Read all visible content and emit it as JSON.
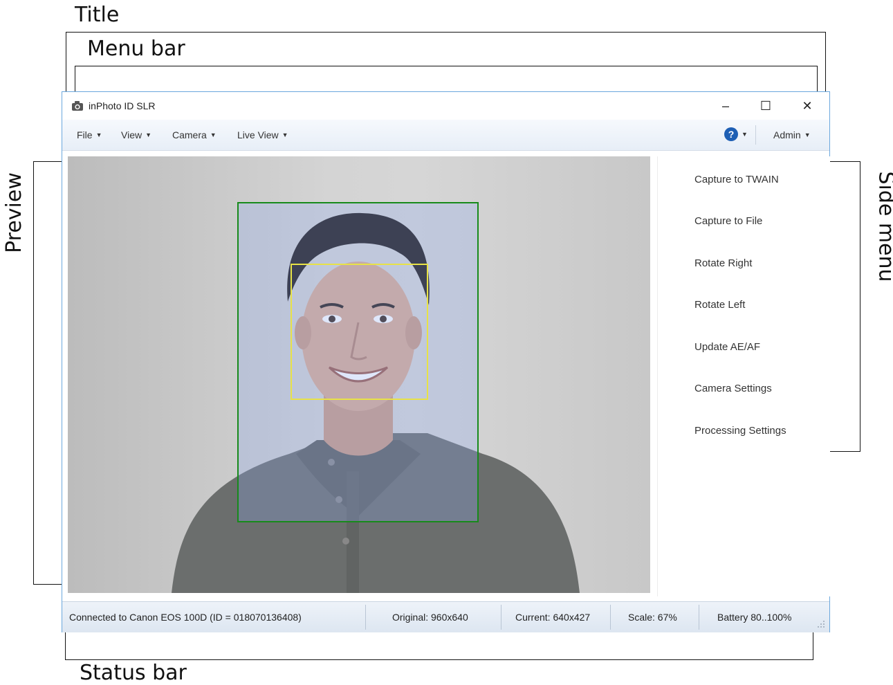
{
  "annotations": {
    "title": "Title",
    "menu_bar": "Menu bar",
    "preview": "Preview",
    "side_menu": "Side menu",
    "status_bar": "Status bar"
  },
  "window": {
    "title": "inPhoto ID SLR",
    "icon": "camera-icon",
    "controls": {
      "minimize": "–",
      "maximize": "☐",
      "close": "✕"
    }
  },
  "menubar": {
    "items": [
      "File",
      "View",
      "Camera",
      "Live View"
    ],
    "help_icon": "help-icon",
    "user": "Admin",
    "caret": "▼"
  },
  "side_menu": {
    "items": [
      "Capture to TWAIN",
      "Capture to File",
      "Rotate Right",
      "Rotate Left",
      "Update AE/AF",
      "Camera Settings",
      "Processing Settings"
    ]
  },
  "statusbar": {
    "connection": "Connected to Canon EOS 100D (ID = 018070136408)",
    "original": "Original: 960x640",
    "current": "Current: 640x427",
    "scale": "Scale: 67%",
    "battery": "Battery 80..100%"
  },
  "colors": {
    "window_border": "#6aa7dd",
    "crop_frame": "#178a1a",
    "face_frame": "#e8e246",
    "help_icon": "#1e5fb4"
  }
}
